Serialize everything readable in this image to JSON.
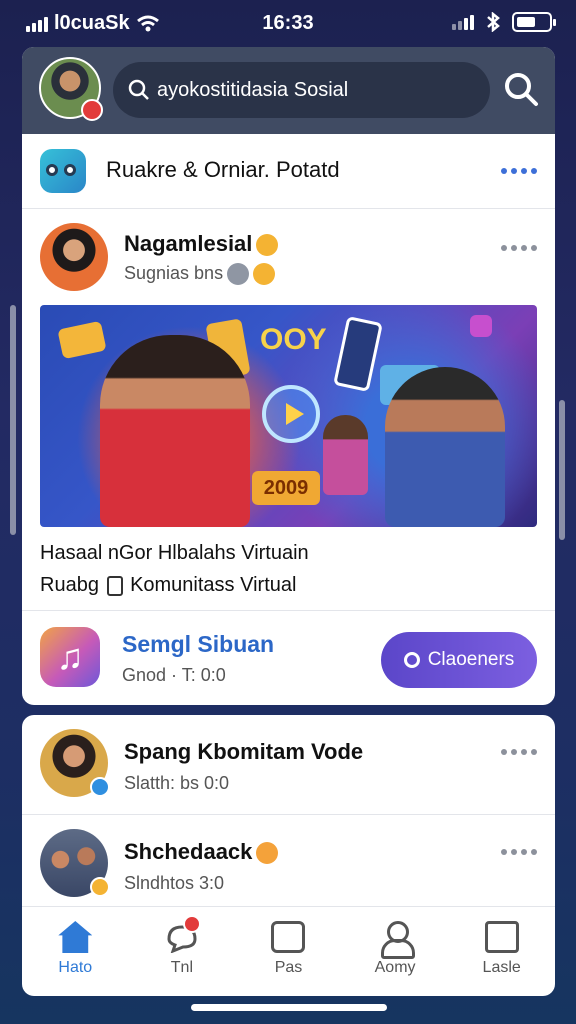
{
  "status_bar": {
    "carrier": "l0cuaSk",
    "time": "16:33"
  },
  "search": {
    "value": "ayokostitidasia Sosial"
  },
  "app_row": {
    "name": "Ruakre & Orniar. Potatd"
  },
  "post": {
    "author": "Nagamlesial",
    "subtitle": "Sugnias bns",
    "media_brand": "OOY",
    "media_year": "2009",
    "caption_line1": "Hasaal nGor Hlbalahs Virtuain",
    "caption_line2_a": "Ruabg",
    "caption_line2_b": "Komunitass Virtual"
  },
  "music_row": {
    "title": "Semgl Sibuan",
    "subtitle": "Gnod · T: 0:0",
    "button_label": "Claoeners"
  },
  "friends": [
    {
      "name": "Spang Kbomitam Vode",
      "subtitle": "Slatth: bs 0:0",
      "badge_color": "#2f8fe0"
    },
    {
      "name": "Shchedaack",
      "subtitle": "Slndhtos 3:0",
      "badge_color": "#f4b333"
    }
  ],
  "nav": {
    "items": [
      {
        "label": "Hato",
        "icon": "home-icon",
        "active": true
      },
      {
        "label": "Tnl",
        "icon": "chat-icon",
        "active": false
      },
      {
        "label": "Pas",
        "icon": "photo-icon",
        "active": false
      },
      {
        "label": "Aomy",
        "icon": "profile-icon",
        "active": false
      },
      {
        "label": "Lasle",
        "icon": "menu-icon",
        "active": false
      }
    ]
  },
  "colors": {
    "accent": "#2f7ad6",
    "button": "#5b46c9",
    "badge": "#e23b3b"
  }
}
